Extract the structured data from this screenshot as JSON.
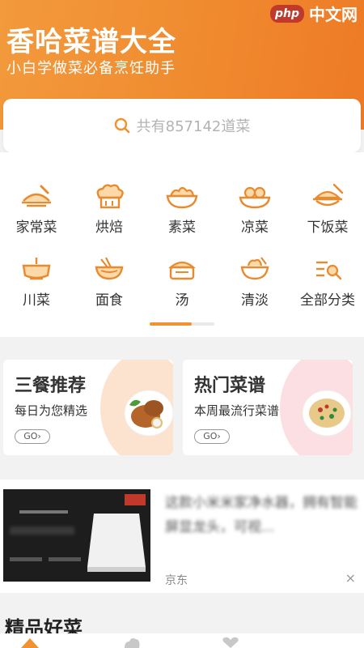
{
  "header": {
    "title": "香哈菜谱大全",
    "subtitle": "小白学做菜必备烹饪助手",
    "watermark_logo": "php",
    "watermark_text": "中文网"
  },
  "search": {
    "placeholder": "共有857142道菜",
    "icon": "search-icon"
  },
  "categories": [
    {
      "label": "家常菜",
      "icon": "home-dish-icon"
    },
    {
      "label": "烘焙",
      "icon": "chef-hat-icon"
    },
    {
      "label": "素菜",
      "icon": "veg-bowl-icon"
    },
    {
      "label": "凉菜",
      "icon": "cold-dish-icon"
    },
    {
      "label": "下饭菜",
      "icon": "rice-dish-icon"
    },
    {
      "label": "川菜",
      "icon": "hotpot-icon"
    },
    {
      "label": "面食",
      "icon": "noodle-bowl-icon"
    },
    {
      "label": "汤",
      "icon": "soup-pot-icon"
    },
    {
      "label": "清淡",
      "icon": "salad-bowl-icon"
    },
    {
      "label": "全部分类",
      "icon": "list-search-icon"
    }
  ],
  "promos": [
    {
      "title": "三餐推荐",
      "subtitle": "每日为您精选",
      "go": "GO"
    },
    {
      "title": "热门菜谱",
      "subtitle": "本周最流行菜谱",
      "go": "GO"
    }
  ],
  "ad": {
    "text": "这款小米米家净水器，拥有智能屏显龙头，可视...",
    "source": "京东",
    "close": "×"
  },
  "section": {
    "title": "精品好菜"
  },
  "colors": {
    "accent": "#f0922f",
    "header_start": "#f29a3c",
    "header_end": "#ee7a26"
  }
}
